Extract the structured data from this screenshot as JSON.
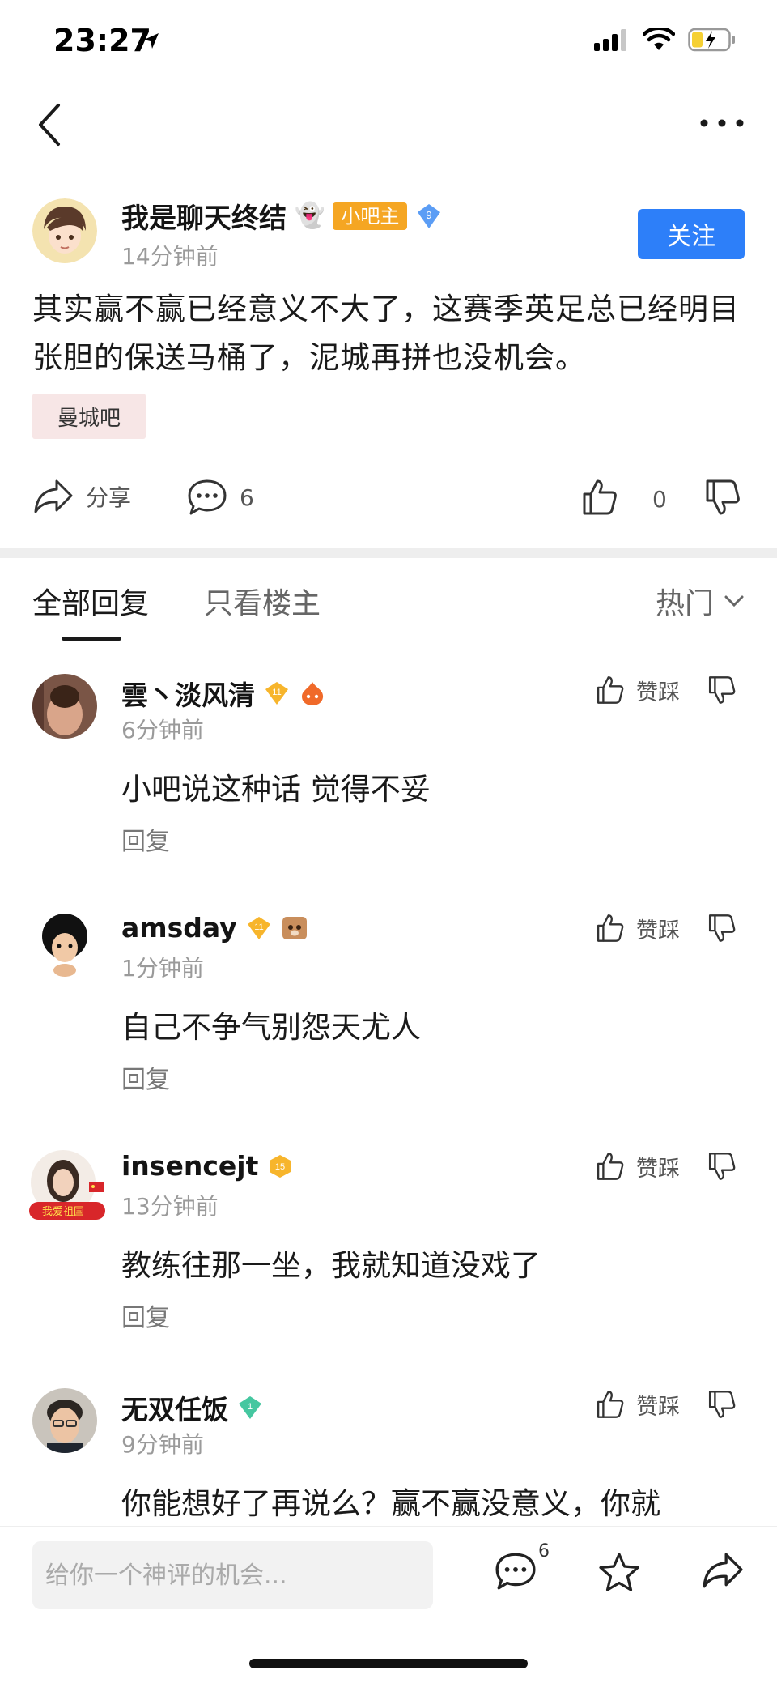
{
  "status_bar": {
    "time": "23:27"
  },
  "post": {
    "author": "我是聊天终结",
    "ghost_emoji": "👻",
    "owner_badge": "小吧主",
    "level": "9",
    "time": "14分钟前",
    "follow_label": "关注",
    "content": "其实赢不赢已经意义不大了，这赛季英足总已经明目张胆的保送马桶了，泥城再拼也没机会。",
    "forum_tag": "曼城吧",
    "share_label": "分享",
    "comment_count": "6",
    "like_count": "0"
  },
  "tabs": {
    "all_replies": "全部回复",
    "owner_only": "只看楼主",
    "sort": "热门"
  },
  "comments": [
    {
      "name": "雲丶淡风清",
      "level": "11",
      "time": "6分钟前",
      "text": "小吧说这种话 觉得不妥",
      "reply": "回复",
      "vote_label": "赞踩"
    },
    {
      "name": "amsday",
      "level": "11",
      "time": "1分钟前",
      "text": "自己不争气别怨天尤人",
      "reply": "回复",
      "vote_label": "赞踩"
    },
    {
      "name": "insencejt",
      "level": "15",
      "time": "13分钟前",
      "text": "教练往那一坐，我就知道没戏了",
      "reply": "回复",
      "vote_label": "赞踩",
      "avatar_caption": "我爱祖国"
    },
    {
      "name": "无双任饭",
      "level": "1",
      "time": "9分钟前",
      "text": "你能想好了再说么？赢不赢没意义，你就",
      "reply": "",
      "vote_label": "赞踩"
    }
  ],
  "bottom_bar": {
    "input_placeholder": "给你一个神评的机会...",
    "comment_count": "6"
  },
  "colors": {
    "accent": "#2d7ff9",
    "owner_badge": "#f5a623",
    "forum_tag_bg": "#f7e6e6",
    "level_gold": "#f7b52c",
    "level_blue": "#5b9df5",
    "level_green": "#45c7a0"
  }
}
